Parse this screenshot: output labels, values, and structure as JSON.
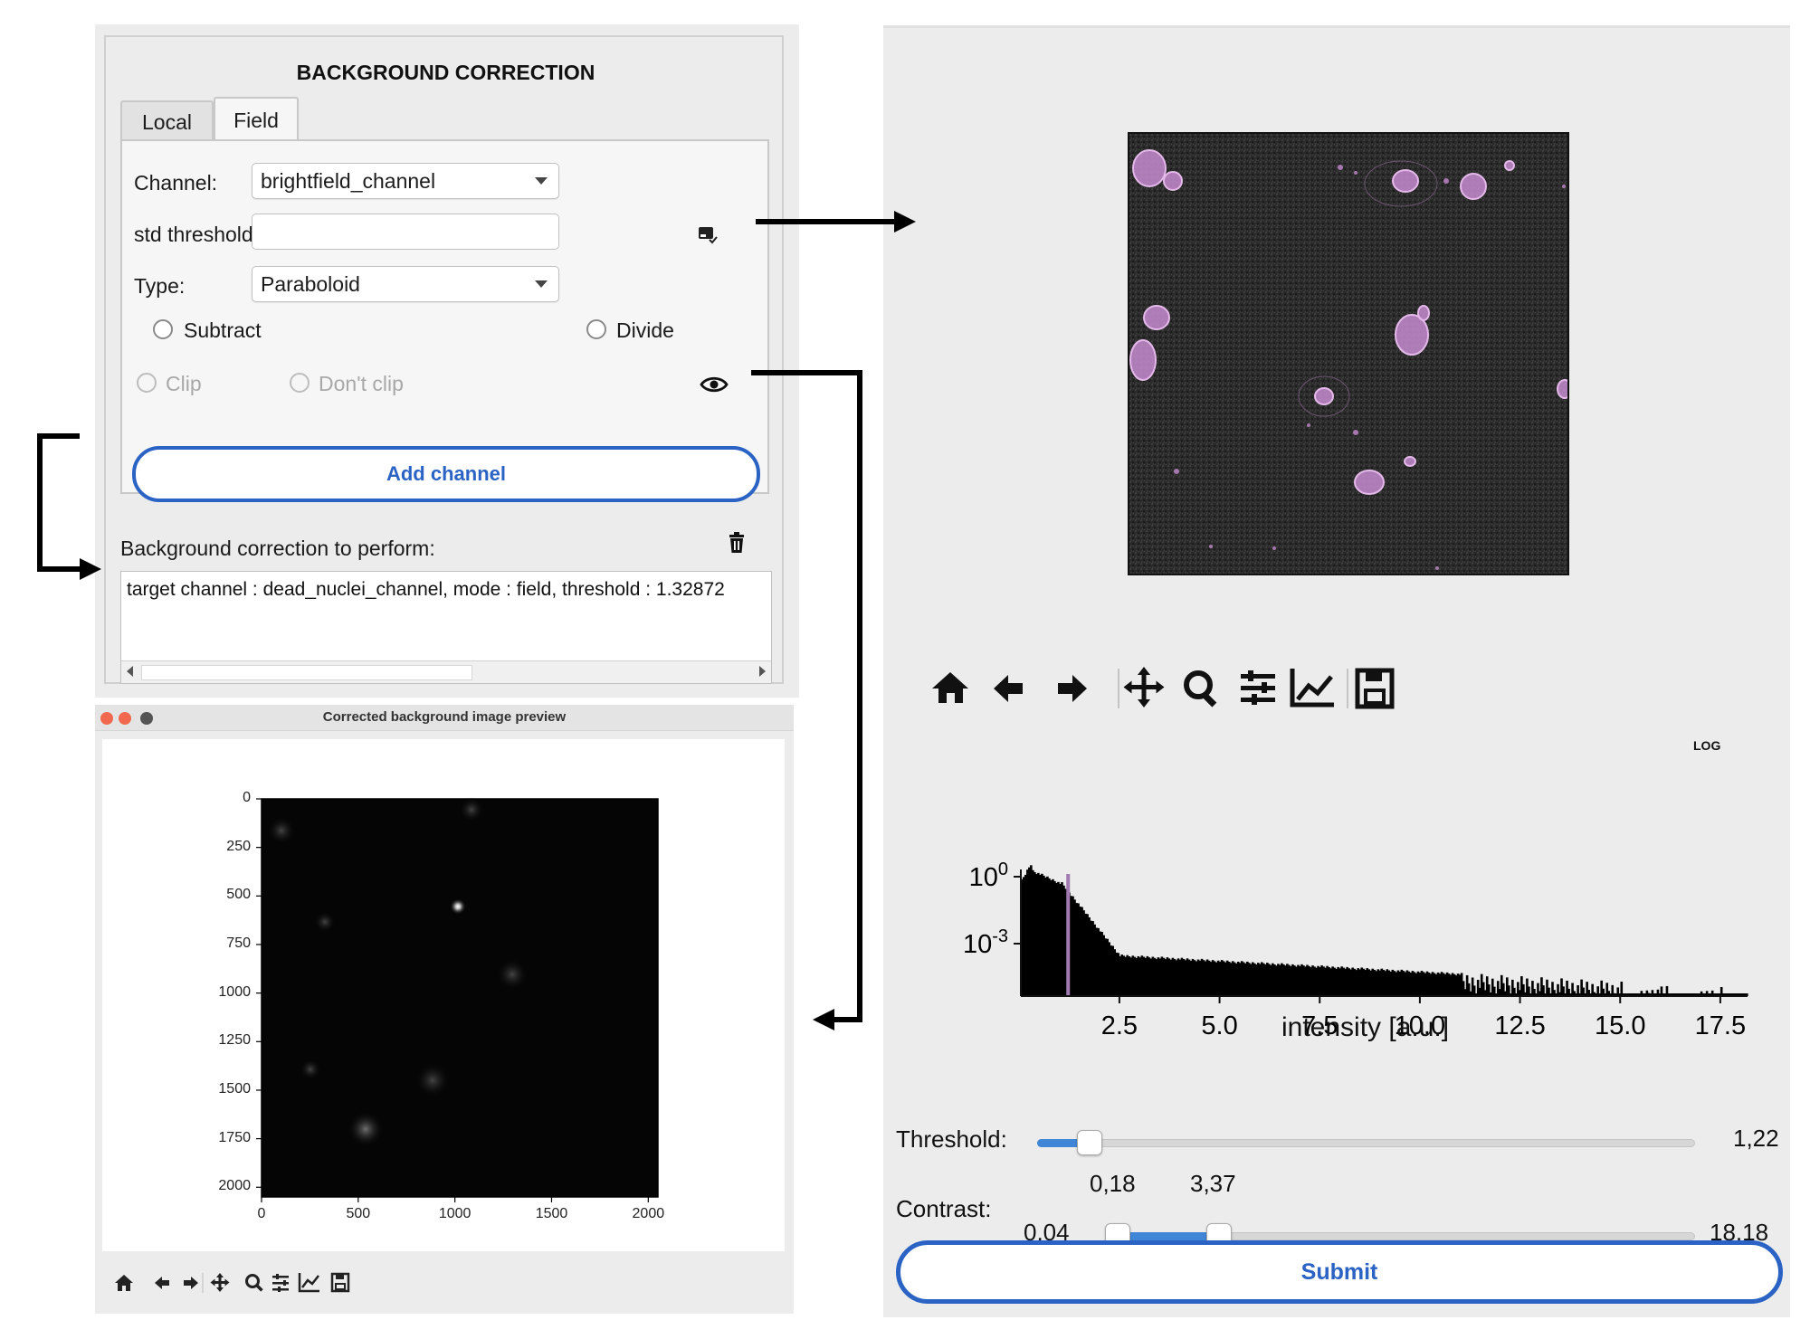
{
  "bg_panel": {
    "title": "BACKGROUND CORRECTION",
    "tabs": [
      {
        "label": "Local",
        "active": false
      },
      {
        "label": "Field",
        "active": true
      }
    ],
    "channel_label": "Channel:",
    "channel_value": "brightfield_channel",
    "std_threshold_label": "std threshold:",
    "std_threshold_value": "",
    "type_label": "Type:",
    "type_value": "Paraboloid",
    "operation_options": [
      {
        "label": "Subtract",
        "checked": false
      },
      {
        "label": "Divide",
        "checked": false
      }
    ],
    "clip_options": [
      {
        "label": "Clip",
        "enabled": false
      },
      {
        "label": "Don't clip",
        "enabled": false
      }
    ],
    "add_channel_label": "Add channel",
    "list_label": "Background correction to perform:",
    "list_items": [
      "target channel : dead_nuclei_channel, mode : field, threshold : 1.32872"
    ]
  },
  "preview": {
    "title": "Corrected background image preview",
    "y_ticks": [
      "0",
      "250",
      "500",
      "750",
      "1000",
      "1250",
      "1500",
      "1750",
      "2000"
    ],
    "x_ticks": [
      "0",
      "500",
      "1000",
      "1500",
      "2000"
    ],
    "toolbar_icons": [
      "home-icon",
      "back-icon",
      "forward-icon",
      "pan-icon",
      "zoom-icon",
      "configure-subplots-icon",
      "edit-axis-icon",
      "save-icon"
    ]
  },
  "right_panel": {
    "toolbar_icons": [
      "home-icon",
      "back-icon",
      "forward-icon",
      "pan-icon",
      "zoom-icon",
      "configure-subplots-icon",
      "edit-axis-icon",
      "save-icon"
    ],
    "log_label": "LOG",
    "threshold_label": "Threshold:",
    "threshold_value": "1,22",
    "threshold_fraction": 0.08,
    "contrast_label": "Contrast:",
    "contrast_min": "0,04",
    "contrast_max": "18,18",
    "contrast_low": "0,18",
    "contrast_high": "3,37",
    "submit_label": "Submit"
  },
  "chart_data": {
    "type": "bar",
    "title": "",
    "xlabel": "intensity [a.u.]",
    "ylabel": "",
    "y_scale": "log",
    "x_ticks": [
      "2.5",
      "5.0",
      "7.5",
      "10.0",
      "12.5",
      "15.0",
      "17.5"
    ],
    "y_ticks": [
      "10^0",
      "10^-3"
    ],
    "xlim": [
      0.04,
      18.18
    ],
    "threshold_line": 1.22,
    "threshold_color": "#a07ab0",
    "series_color": "#000000"
  },
  "colors": {
    "accent": "#2a63c4",
    "slider_fill": "#3f86d6",
    "magenta_overlay": "#c58bd0"
  }
}
